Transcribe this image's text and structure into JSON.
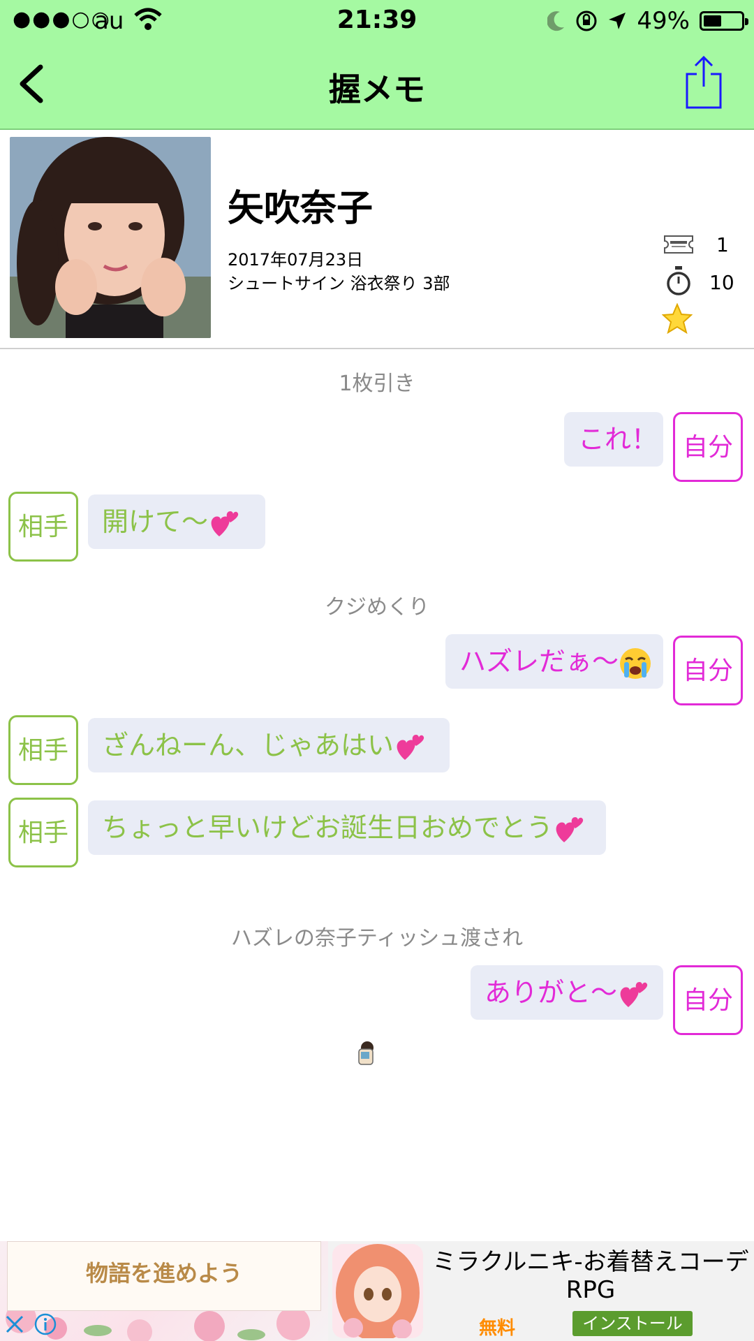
{
  "status_bar": {
    "signal": "●●●○○",
    "carrier": "au",
    "time": "21:39",
    "battery": "49%",
    "battery_level": 0.49
  },
  "nav": {
    "title": "握メモ",
    "back_icon": "chevron-left-icon",
    "share_icon": "share-icon"
  },
  "profile": {
    "name": "矢吹奈子",
    "date": "2017年07月23日",
    "event": "シュートサイン 浴衣祭り 3部",
    "tickets": "1",
    "seconds": "10",
    "rating_stars": 1,
    "icons": [
      "ticket-icon",
      "stopwatch-icon",
      "star-icon"
    ]
  },
  "chat": {
    "sections": [
      {
        "label": "1枚引き",
        "messages": [
          {
            "from": "me",
            "tag": "自分",
            "text": "これ！"
          },
          {
            "from": "them",
            "tag": "相手",
            "text": "開けて〜",
            "emoji": "heart-icon"
          }
        ]
      },
      {
        "label": "クジめくり",
        "messages": [
          {
            "from": "me",
            "tag": "自分",
            "text": "ハズレだぁ〜",
            "emoji": "crying-face-icon"
          },
          {
            "from": "them",
            "tag": "相手",
            "text": "ざんねーん、じゃあはい",
            "emoji": "heart-icon"
          },
          {
            "from": "them",
            "tag": "相手",
            "text": "ちょっと早いけどお誕生日おめでとう",
            "emoji": "heart-icon"
          }
        ]
      },
      {
        "label": "ハズレの奈子ティッシュ渡され",
        "messages": [
          {
            "from": "me",
            "tag": "自分",
            "text": "ありがと〜",
            "emoji": "heart-icon"
          }
        ]
      }
    ]
  },
  "ad": {
    "banner_text": "物語を進めよう",
    "title": "ミラクルニキ-お着替えコーデRPG",
    "price": "無料",
    "install": "インストール"
  },
  "colors": {
    "header_bg": "#a5f9a2",
    "me": "#e22ad7",
    "them": "#8cc248",
    "bubble_bg": "#e9ecf6",
    "share": "#1a1aff"
  }
}
